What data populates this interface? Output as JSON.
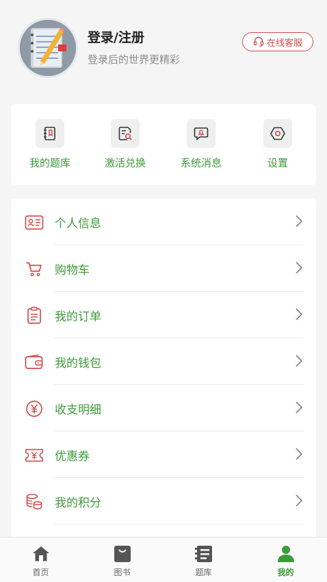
{
  "profile": {
    "title": "登录/注册",
    "subtitle": "登录后的世界更精彩",
    "service_label": "在线客服"
  },
  "quick_actions": [
    {
      "label": "我的题库",
      "icon": "book-icon"
    },
    {
      "label": "激活兑换",
      "icon": "activate-icon"
    },
    {
      "label": "系统消息",
      "icon": "bell-message-icon"
    },
    {
      "label": "设置",
      "icon": "settings-icon"
    }
  ],
  "menu": [
    {
      "label": "个人信息",
      "icon": "id-card-icon"
    },
    {
      "label": "购物车",
      "icon": "cart-icon"
    },
    {
      "label": "我的订单",
      "icon": "order-icon"
    },
    {
      "label": "我的钱包",
      "icon": "wallet-icon"
    },
    {
      "label": "收支明细",
      "icon": "yen-circle-icon"
    },
    {
      "label": "优惠券",
      "icon": "coupon-icon"
    },
    {
      "label": "我的积分",
      "icon": "coins-icon"
    }
  ],
  "tabs": [
    {
      "label": "首页",
      "icon": "home-icon"
    },
    {
      "label": "图书",
      "icon": "bag-icon"
    },
    {
      "label": "题库",
      "icon": "question-bank-icon"
    },
    {
      "label": "我的",
      "icon": "user-icon",
      "active": true
    }
  ],
  "colors": {
    "accent_green": "#3d9a3a",
    "accent_red": "#d24b4b",
    "background": "#f5f5f5"
  }
}
